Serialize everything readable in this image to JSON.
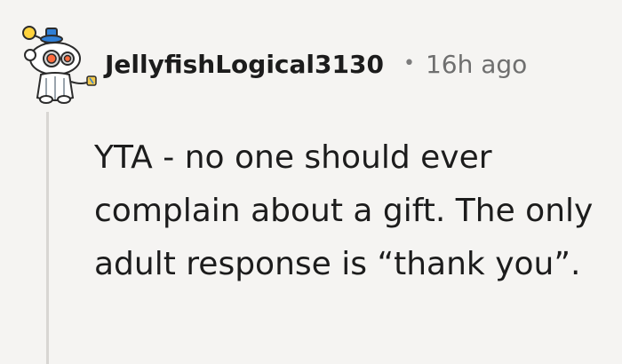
{
  "comment": {
    "author": "JellyfishLogical3130",
    "separator": "•",
    "timestamp": "16h ago",
    "body": "YTA - no one should ever complain about a gift. The only adult response is “thank you”.",
    "avatar_icon": "snoo-avatar-icon"
  },
  "colors": {
    "background": "#f5f4f2",
    "text": "#1c1c1c",
    "meta": "#6f6f6f",
    "thread_line": "#d8d6d3",
    "avatar_accent": "#2f7fd6"
  }
}
